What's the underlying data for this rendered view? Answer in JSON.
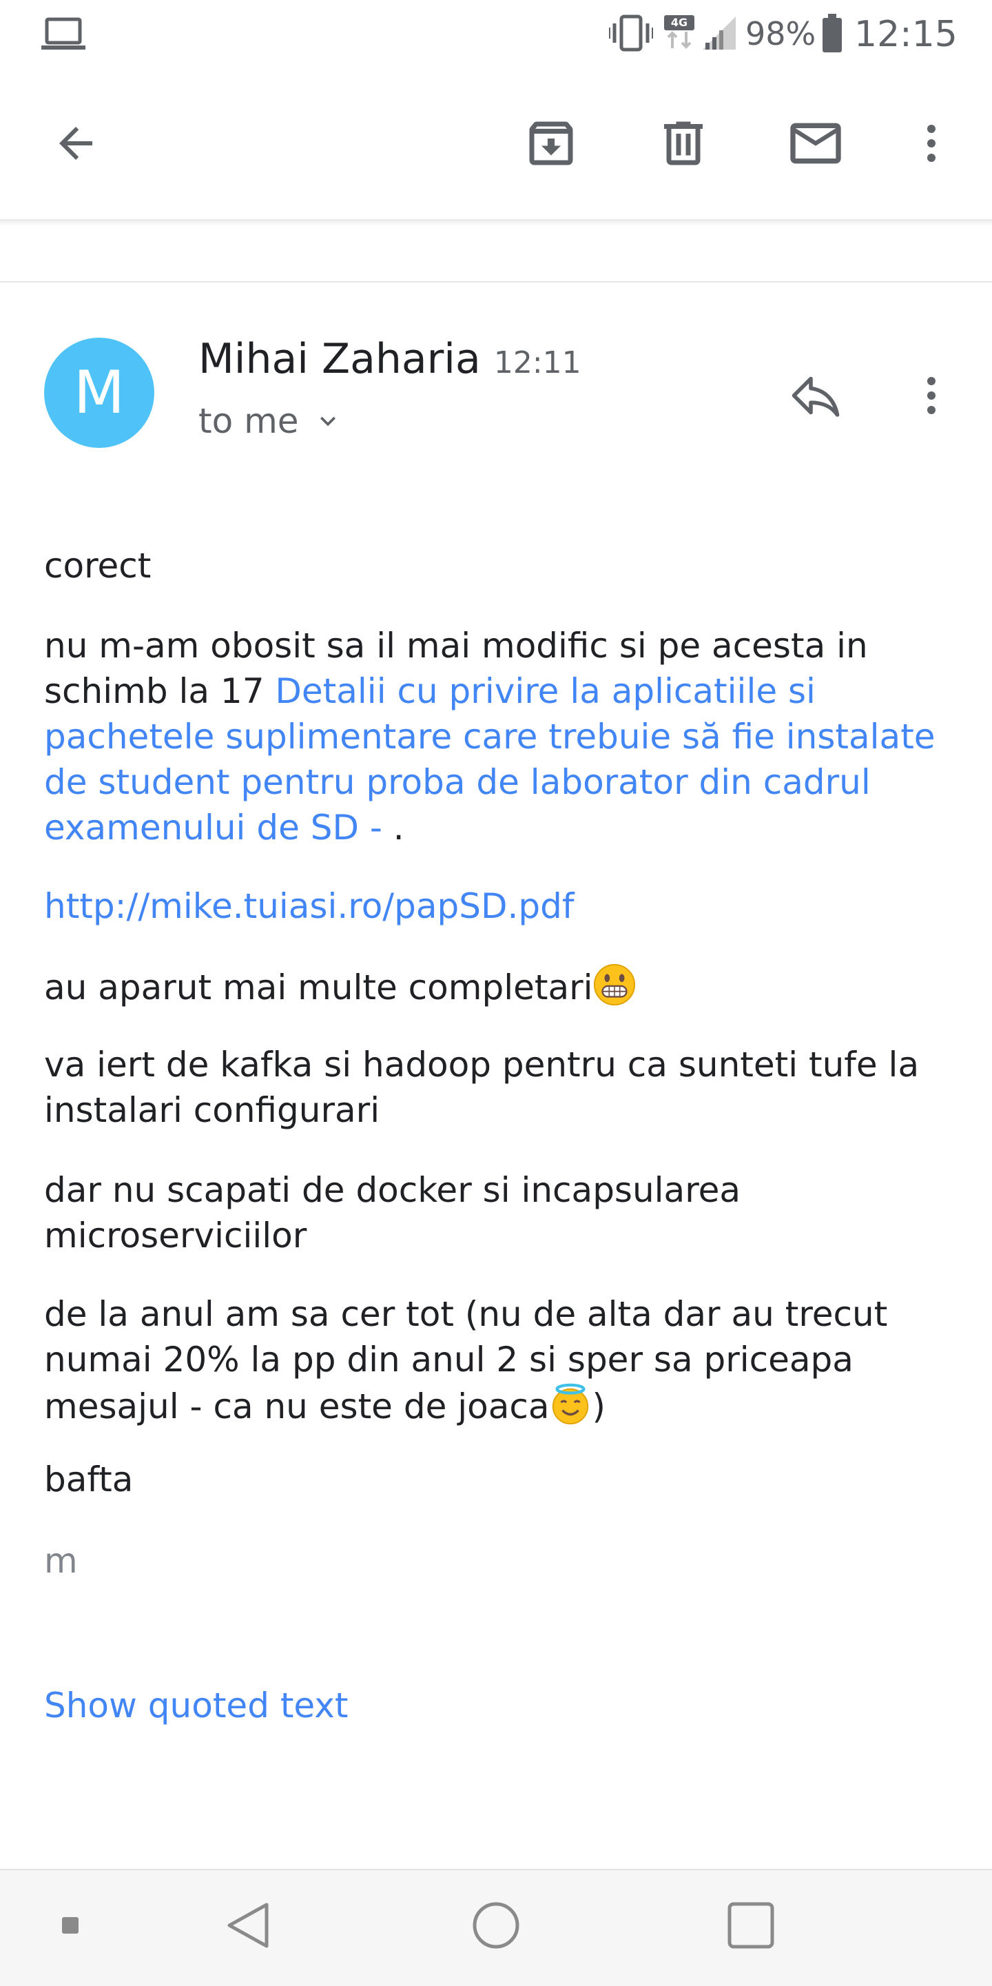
{
  "status_bar": {
    "network": "4G",
    "battery": "98%",
    "time": "12:15"
  },
  "toolbar": {
    "icons": [
      "back-arrow-icon",
      "archive-icon",
      "delete-icon",
      "mail-icon",
      "more-vert-icon"
    ]
  },
  "message": {
    "avatar_letter": "M",
    "sender": "Mihai Zaharia",
    "time": "12:11",
    "recipient": "to me",
    "paragraphs": {
      "p1": "corect",
      "p2_text": "nu m-am obosit sa il mai modific si pe acesta in schimb la 17 ",
      "p2_link": "Detalii cu privire la aplicatiile si pachetele suplimentare care trebuie să fie instalate de student pentru proba de laborator din cadrul examenului de SD - ",
      "p2_tail": ".",
      "p3_link": "http://mike.tuiasi.ro/papSD.pdf",
      "p4": "au aparut mai multe completari",
      "p5": "va iert de kafka si hadoop pentru ca sunteti tufe la instalari configurari",
      "p6": "dar nu scapati de docker si incapsularea microserviciilor",
      "p7_text": "de la anul am sa cer tot (nu de alta dar au trecut numai 20% la pp din anul 2 si sper sa priceapa mesajul - ca nu este de joaca",
      "p7_tail": ")",
      "p8": "bafta",
      "signature": "m"
    },
    "show_quoted": "Show quoted text"
  },
  "colors": {
    "link": "#4285f4",
    "avatar": "#4fc3f7",
    "icon": "#5f6368"
  }
}
